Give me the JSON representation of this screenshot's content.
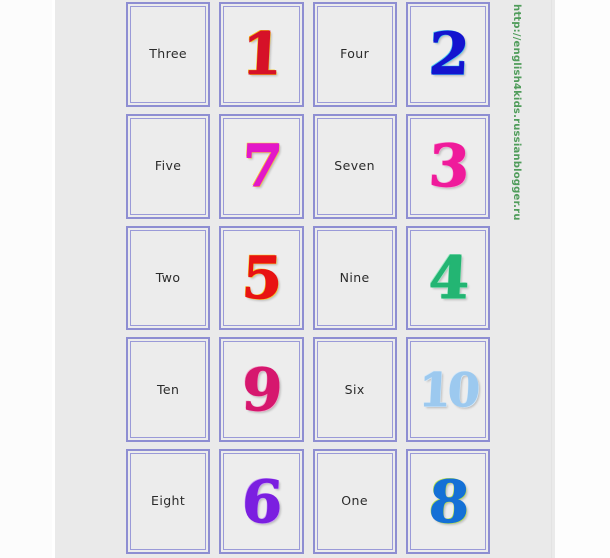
{
  "page": {
    "background_color": "#eaeaea",
    "outer_background_color": "#ffffff",
    "card_border_color": "#8e8ed2",
    "card_face_color": "#ececec",
    "word_text_color": "#2b2b2b"
  },
  "watermark": {
    "text": "http://english4kids.russianblogger.ru",
    "color": "#4f9c5a",
    "orientation": "vertical"
  },
  "grid": {
    "columns": 4,
    "rows": 5
  },
  "cards": [
    {
      "type": "word",
      "label": "Three",
      "name": "card-word-three"
    },
    {
      "type": "numeral",
      "label": "1",
      "name": "card-numeral-1",
      "color": "#d61128",
      "highlight": "#f5c518"
    },
    {
      "type": "word",
      "label": "Four",
      "name": "card-word-four"
    },
    {
      "type": "numeral",
      "label": "2",
      "name": "card-numeral-2",
      "color": "#1414cf",
      "highlight": "#4fd0f0"
    },
    {
      "type": "word",
      "label": "Five",
      "name": "card-word-five"
    },
    {
      "type": "numeral",
      "label": "7",
      "name": "card-numeral-7",
      "color": "#e318c8",
      "highlight": "#f7c838"
    },
    {
      "type": "word",
      "label": "Seven",
      "name": "card-word-seven"
    },
    {
      "type": "numeral",
      "label": "3",
      "name": "card-numeral-3",
      "color": "#ef1b9b",
      "highlight": "#f9a6d4"
    },
    {
      "type": "word",
      "label": "Two",
      "name": "card-word-two"
    },
    {
      "type": "numeral",
      "label": "5",
      "name": "card-numeral-5",
      "color": "#e81313",
      "highlight": "#f7d02e"
    },
    {
      "type": "word",
      "label": "Nine",
      "name": "card-word-nine"
    },
    {
      "type": "numeral",
      "label": "4",
      "name": "card-numeral-4",
      "color": "#23b573",
      "highlight": "#9fe8c4"
    },
    {
      "type": "word",
      "label": "Ten",
      "name": "card-word-ten"
    },
    {
      "type": "numeral",
      "label": "9",
      "name": "card-numeral-9",
      "color": "#d6176e",
      "highlight": "#f3a5c8"
    },
    {
      "type": "word",
      "label": "Six",
      "name": "card-word-six"
    },
    {
      "type": "numeral",
      "label": "10",
      "name": "card-numeral-10",
      "color": "#9cc9ef",
      "highlight": "#d4e8f8"
    },
    {
      "type": "word",
      "label": "Eight",
      "name": "card-word-eight"
    },
    {
      "type": "numeral",
      "label": "6",
      "name": "card-numeral-6",
      "color": "#7b1fe0",
      "highlight": "#c79bf5"
    },
    {
      "type": "word",
      "label": "One",
      "name": "card-word-one"
    },
    {
      "type": "numeral",
      "label": "8",
      "name": "card-numeral-8",
      "color": "#1470d6",
      "highlight": "#b9e04e"
    }
  ]
}
